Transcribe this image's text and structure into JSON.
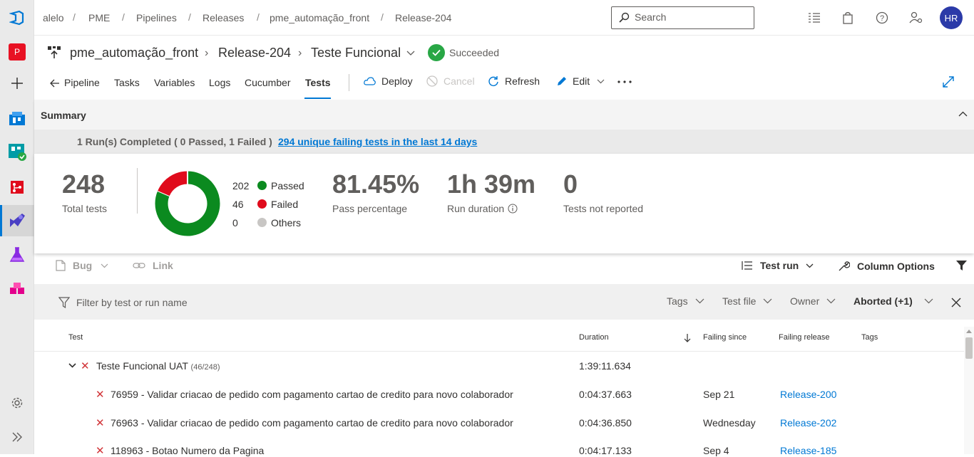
{
  "breadcrumb": [
    "alelo",
    "PME",
    "Pipelines",
    "Releases",
    "pme_automação_front",
    "Release-204"
  ],
  "search": {
    "placeholder": "Search"
  },
  "user": {
    "initials": "HR"
  },
  "rail_items": [
    "project-avatar-icon",
    "add-icon",
    "boards-icon",
    "repos-test-icon",
    "repos-icon",
    "pipelines-icon",
    "test-plans-icon",
    "artifacts-icon"
  ],
  "release_header": {
    "pipeline": "pme_automação_front",
    "release": "Release-204",
    "stage": "Teste Funcional",
    "status": "Succeeded"
  },
  "tabs": {
    "back": "Pipeline",
    "items": [
      "Tasks",
      "Variables",
      "Logs",
      "Cucumber",
      "Tests"
    ],
    "active": "Tests"
  },
  "commands": {
    "deploy": "Deploy",
    "cancel": "Cancel",
    "refresh": "Refresh",
    "edit": "Edit"
  },
  "summary": {
    "title": "Summary",
    "runs_text": "1 Run(s) Completed ( 0 Passed, 1 Failed )",
    "failing_link": "294 unique failing tests in the last 14 days",
    "total": "248",
    "total_label": "Total tests",
    "legend": [
      {
        "count": "202",
        "label": "Passed",
        "color": "#0b8a1f"
      },
      {
        "count": "46",
        "label": "Failed",
        "color": "#e00b1c"
      },
      {
        "count": "0",
        "label": "Others",
        "color": "#c8c6c4"
      }
    ],
    "pass_pct": "81.45%",
    "pass_label": "Pass percentage",
    "duration": "1h 39m",
    "duration_label": "Run duration",
    "not_reported": "0",
    "not_reported_label": "Tests not reported"
  },
  "chart_data": {
    "type": "pie",
    "categories": [
      "Passed",
      "Failed",
      "Others"
    ],
    "values": [
      202,
      46,
      0
    ],
    "colors": [
      "#0b8a1f",
      "#e00b1c",
      "#c8c6c4"
    ]
  },
  "toolbar": {
    "bug": "Bug",
    "link": "Link",
    "test_run": "Test run",
    "column_options": "Column Options"
  },
  "filters": {
    "placeholder": "Filter by test or run name",
    "tags": "Tags",
    "test_file": "Test file",
    "owner": "Owner",
    "outcome": "Aborted (+1)"
  },
  "table": {
    "headers": {
      "test": "Test",
      "duration": "Duration",
      "failing_since": "Failing since",
      "failing_release": "Failing release",
      "tags": "Tags"
    },
    "group": {
      "name": "Teste Funcional UAT",
      "count": "(46/248)",
      "duration": "1:39:11.634"
    },
    "rows": [
      {
        "name": "76959 - Validar criacao de pedido com pagamento cartao de credito para novo colaborador",
        "duration": "0:04:37.663",
        "failing_since": "Sep 21",
        "release": "Release-200"
      },
      {
        "name": "76963 - Validar criacao de pedido com pagamento cartao de credito para novo colaborador",
        "duration": "0:04:36.850",
        "failing_since": "Wednesday",
        "release": "Release-202"
      },
      {
        "name": "118963 - Botao Numero da Pagina",
        "duration": "0:04:17.133",
        "failing_since": "Sep 4",
        "release": "Release-185"
      }
    ]
  }
}
